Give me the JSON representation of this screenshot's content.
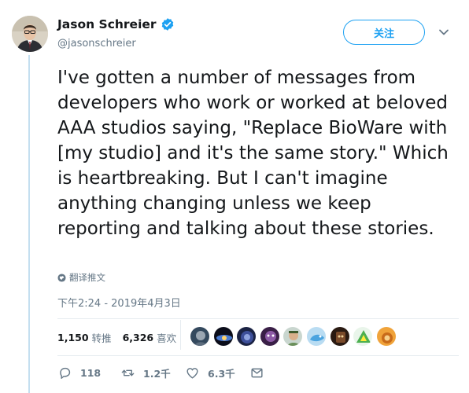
{
  "author": {
    "display_name": "Jason Schreier",
    "handle": "@jasonschreier",
    "verified": true
  },
  "follow_button": {
    "label": "关注"
  },
  "tweet": {
    "text": "I've gotten a number of messages from developers who work or worked at beloved AAA studios saying, \"Replace BioWare with [my studio] and it's the same story.\" Which is heartbreaking. But I can't imagine anything changing unless we keep reporting and talking about these stories.",
    "translate_label": "翻译推文",
    "timestamp": "下午2:24 - 2019年4月3日"
  },
  "stats": {
    "retweets": {
      "count": "1,150",
      "label": "转推"
    },
    "likes": {
      "count": "6,326",
      "label": "喜欢"
    }
  },
  "likers": [
    {
      "icon": "liker-avatar-1"
    },
    {
      "icon": "liker-avatar-2"
    },
    {
      "icon": "liker-avatar-3"
    },
    {
      "icon": "liker-avatar-4"
    },
    {
      "icon": "liker-avatar-5"
    },
    {
      "icon": "liker-avatar-6"
    },
    {
      "icon": "liker-avatar-7"
    },
    {
      "icon": "liker-avatar-8"
    },
    {
      "icon": "liker-avatar-9"
    }
  ],
  "actions": {
    "reply_count": "118",
    "retweet_count": "1.2千",
    "like_count": "6.3千"
  },
  "colors": {
    "accent": "#1da1f2",
    "secondary_text": "#657786",
    "thread_line": "#c4dff0"
  }
}
